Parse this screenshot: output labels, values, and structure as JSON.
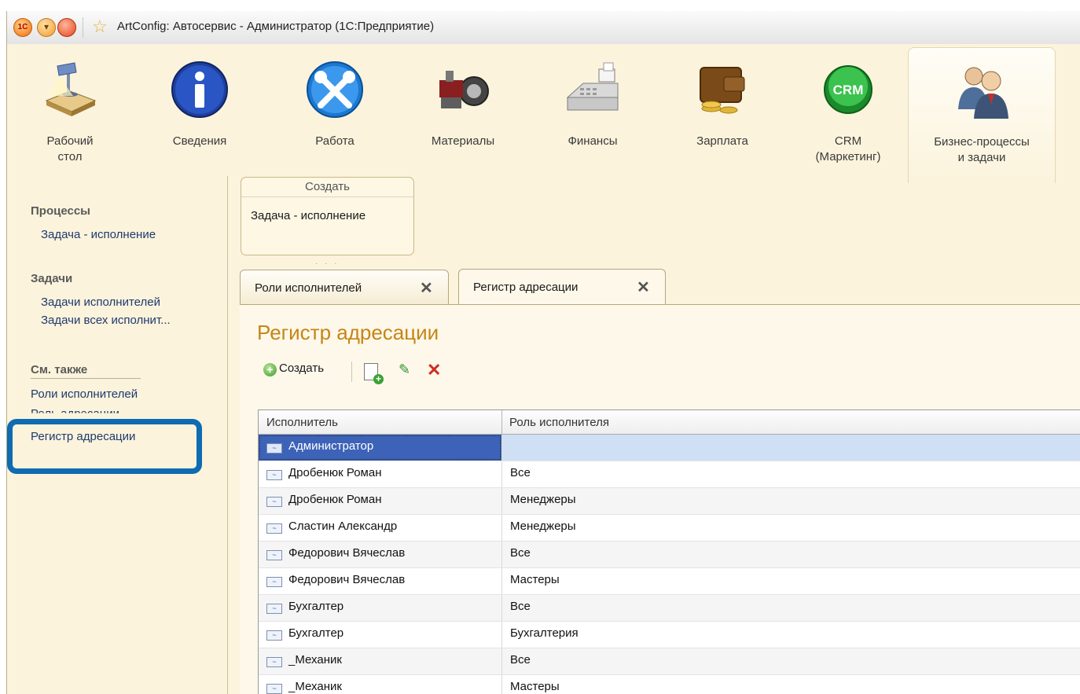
{
  "window": {
    "title": "ArtConfig: Автосервис - Администратор  (1С:Предприятие)",
    "logo_text": "1С"
  },
  "sections": [
    {
      "label": "Рабочий\nстол",
      "icon": "desk-lamp-icon"
    },
    {
      "label": "Сведения",
      "icon": "info-icon"
    },
    {
      "label": "Работа",
      "icon": "tools-icon"
    },
    {
      "label": "Материалы",
      "icon": "parts-icon"
    },
    {
      "label": "Финансы",
      "icon": "cash-register-icon"
    },
    {
      "label": "Зарплата",
      "icon": "wallet-icon"
    },
    {
      "label": "CRM\n(Маркетинг)",
      "icon": "crm-icon",
      "icon_text": "CRM"
    },
    {
      "label": "Бизнес-процессы\nи задачи",
      "icon": "people-icon",
      "active": true
    }
  ],
  "sidebar": {
    "processes_header": "Процессы",
    "processes_items": [
      "Задача - исполнение"
    ],
    "tasks_header": "Задачи",
    "tasks_items": [
      "Задачи исполнителей",
      "Задачи всех исполнит..."
    ],
    "see_also_header": "См. также",
    "see_also_items": [
      "Роли исполнителей",
      "Роль адресации",
      "Регистр адресации"
    ]
  },
  "create_panel": {
    "title": "Создать",
    "item": "Задача - исполнение"
  },
  "tabs": [
    {
      "label": "Роли исполнителей",
      "close": "✕"
    },
    {
      "label": "Регистр адресации",
      "close": "✕",
      "active": true
    }
  ],
  "form": {
    "title": "Регистр адресации",
    "toolbar": {
      "create_label": "Создать"
    },
    "columns": [
      "Исполнитель",
      "Роль исполнителя"
    ],
    "rows": [
      {
        "performer": "Администратор",
        "role": "",
        "selected": true
      },
      {
        "performer": "Дробенюк Роман",
        "role": "Все"
      },
      {
        "performer": "Дробенюк Роман",
        "role": "Менеджеры"
      },
      {
        "performer": "Сластин Александр",
        "role": "Менеджеры"
      },
      {
        "performer": "Федорович Вячеслав",
        "role": "Все"
      },
      {
        "performer": "Федорович Вячеслав",
        "role": "Мастеры"
      },
      {
        "performer": "Бухгалтер",
        "role": "Все"
      },
      {
        "performer": "Бухгалтер",
        "role": "Бухгалтерия"
      },
      {
        "performer": "_Механик",
        "role": "Все"
      },
      {
        "performer": "_Механик",
        "role": "Мастеры"
      }
    ]
  },
  "colors": {
    "highlight": "#0f6bb2",
    "title_accent": "#c68516",
    "selection": "#3d63b8"
  }
}
